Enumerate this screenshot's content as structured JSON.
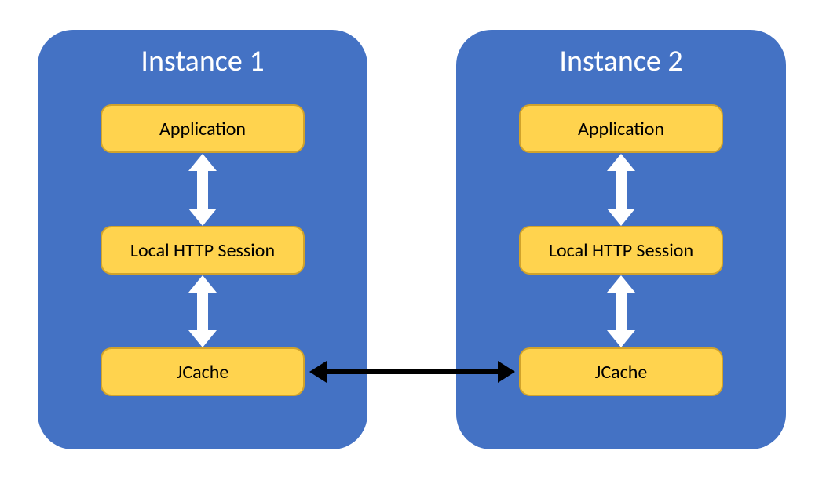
{
  "colors": {
    "instance_bg": "#4472C4",
    "box_fill": "#FFD34E",
    "box_border": "#D1A32B",
    "vert_arrow": "#FFFFFF",
    "horiz_arrow": "#000000"
  },
  "instances": [
    {
      "title": "Instance 1",
      "layers": {
        "app": "Application",
        "session": "Local HTTP Session",
        "jcache": "JCache"
      }
    },
    {
      "title": "Instance 2",
      "layers": {
        "app": "Application",
        "session": "Local HTTP Session",
        "jcache": "JCache"
      }
    }
  ],
  "connections": [
    {
      "from": "instance1.app",
      "to": "instance1.session",
      "style": "white-vertical-bidir"
    },
    {
      "from": "instance1.session",
      "to": "instance1.jcache",
      "style": "white-vertical-bidir"
    },
    {
      "from": "instance2.app",
      "to": "instance2.session",
      "style": "white-vertical-bidir"
    },
    {
      "from": "instance2.session",
      "to": "instance2.jcache",
      "style": "white-vertical-bidir"
    },
    {
      "from": "instance1.jcache",
      "to": "instance2.jcache",
      "style": "black-horizontal-bidir"
    }
  ]
}
